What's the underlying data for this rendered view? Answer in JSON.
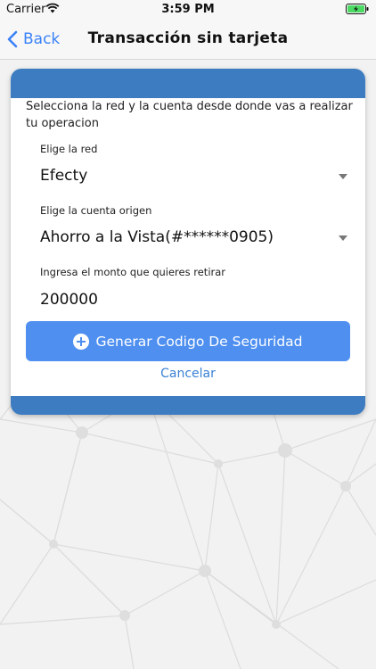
{
  "status_bar": {
    "carrier": "Carrier",
    "time": "3:59 PM"
  },
  "nav": {
    "back_label": "Back",
    "title": "Transacción sin tarjeta"
  },
  "form": {
    "instruction": "Selecciona la red y la cuenta desde donde vas a realizar tu operacion",
    "network_label": "Elige la red",
    "network_value": "Efecty",
    "account_label": "Elige la cuenta origen",
    "account_value": "Ahorro a la Vista(#******0905)",
    "amount_label": "Ingresa el monto que quieres retirar",
    "amount_value": "200000",
    "generate_button": "Generar Codigo De Seguridad",
    "cancel_label": "Cancelar"
  },
  "colors": {
    "accent": "#4e8ff0",
    "card_band": "#3d7cc0",
    "link": "#3a82d4",
    "battery": "#4cd964"
  },
  "icons": [
    "wifi-icon",
    "battery-charging-icon",
    "chevron-left-icon",
    "dropdown-caret-icon",
    "plus-circle-icon"
  ]
}
